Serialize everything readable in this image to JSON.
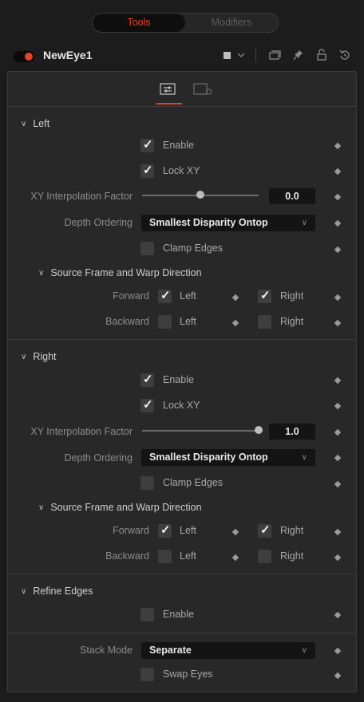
{
  "tabs": {
    "tools": "Tools",
    "modifiers": "Modifiers"
  },
  "node": {
    "name": "NewEye1",
    "enabled": true,
    "accent": "#e8412c",
    "header_icons": [
      "color-swatch-icon",
      "chevron-down-icon",
      "window-icon",
      "pin-icon",
      "lock-icon",
      "reset-icon"
    ]
  },
  "control_tabs": [
    "sliders-icon",
    "settings-tab-icon"
  ],
  "left": {
    "title": "Left",
    "enable_label": "Enable",
    "enable_checked": true,
    "lockxy_label": "Lock XY",
    "lockxy_checked": true,
    "interp_label": "XY Interpolation Factor",
    "interp_value": "0.0",
    "interp_fraction": 0.5,
    "depth_label": "Depth Ordering",
    "depth_value": "Smallest Disparity Ontop",
    "clamp_label": "Clamp Edges",
    "clamp_checked": false,
    "source_title": "Source Frame and Warp Direction",
    "forward_label": "Forward",
    "backward_label": "Backward",
    "left_label": "Left",
    "right_label": "Right",
    "fwd_left": true,
    "fwd_right": true,
    "bwd_left": false,
    "bwd_right": false
  },
  "right": {
    "title": "Right",
    "enable_label": "Enable",
    "enable_checked": true,
    "lockxy_label": "Lock XY",
    "lockxy_checked": true,
    "interp_label": "XY Interpolation Factor",
    "interp_value": "1.0",
    "interp_fraction": 1.0,
    "depth_label": "Depth Ordering",
    "depth_value": "Smallest Disparity Ontop",
    "clamp_label": "Clamp Edges",
    "clamp_checked": false,
    "source_title": "Source Frame and Warp Direction",
    "forward_label": "Forward",
    "backward_label": "Backward",
    "left_label": "Left",
    "right_label": "Right",
    "fwd_left": true,
    "fwd_right": true,
    "bwd_left": false,
    "bwd_right": false
  },
  "refine": {
    "title": "Refine Edges",
    "enable_label": "Enable",
    "enable_checked": false
  },
  "stack": {
    "label": "Stack Mode",
    "value": "Separate",
    "swap_label": "Swap Eyes",
    "swap_checked": false
  }
}
